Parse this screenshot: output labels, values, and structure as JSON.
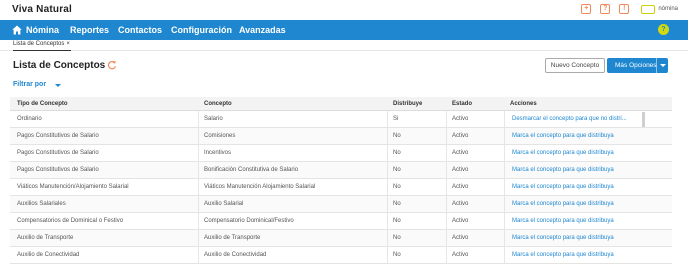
{
  "app": {
    "brand": "Viva Natural",
    "logo_text": "nómina"
  },
  "top_icons": [
    {
      "name": "add-icon",
      "glyph": "+"
    },
    {
      "name": "help-icon",
      "glyph": "?"
    },
    {
      "name": "alert-icon",
      "glyph": "!"
    }
  ],
  "nav": {
    "items": [
      "Nómina",
      "Reportes",
      "Contactos",
      "Configuración",
      "Avanzadas"
    ],
    "help_badge": "?"
  },
  "tabs": [
    {
      "label": "Lista de Conceptos",
      "close": "×"
    }
  ],
  "page": {
    "title": "Lista de Conceptos",
    "new_button": "Nuevo Concepto",
    "more_button": "Más Opciones",
    "filter_label": "Filtrar por"
  },
  "table": {
    "headers": [
      "Tipo de Concepto",
      "Concepto",
      "Distribuye",
      "Estado",
      "Acciones"
    ],
    "rows": [
      [
        "Ordinario",
        "Salario",
        "Si",
        "Activo",
        "Desmarcar el concepto para que no distri..."
      ],
      [
        "Pagos Constitutivos de Salario",
        "Comisiones",
        "No",
        "Activo",
        "Marca el concepto para que distribuya"
      ],
      [
        "Pagos Constitutivos de Salario",
        "Incentivos",
        "No",
        "Activo",
        "Marca el concepto para que distribuya"
      ],
      [
        "Pagos Constitutivos de Salario",
        "Bonificación Constitutiva de Salario",
        "No",
        "Activo",
        "Marca el concepto para que distribuya"
      ],
      [
        "Viáticos Manutención/Alojamiento Salarial",
        "Viáticos Manutención Alojamiento Salarial",
        "No",
        "Activo",
        "Marca el concepto para que distribuya"
      ],
      [
        "Auxilios Salariales",
        "Auxilio Salarial",
        "No",
        "Activo",
        "Marca el concepto para que distribuya"
      ],
      [
        "Compensatorios de Dominical o Festivo",
        "Compensatorio Dominical/Festivo",
        "No",
        "Activo",
        "Marca el concepto para que distribuya"
      ],
      [
        "Auxilio de Transporte",
        "Auxilio de Transporte",
        "No",
        "Activo",
        "Marca el concepto para que distribuya"
      ],
      [
        "Auxilio de Conectividad",
        "Auxilio de Conectividad",
        "No",
        "Activo",
        "Marca el concepto para que distribuya"
      ]
    ]
  },
  "colors": {
    "primary": "#1e87d0",
    "accent": "#d3d90f",
    "alert": "#f08a5d"
  }
}
